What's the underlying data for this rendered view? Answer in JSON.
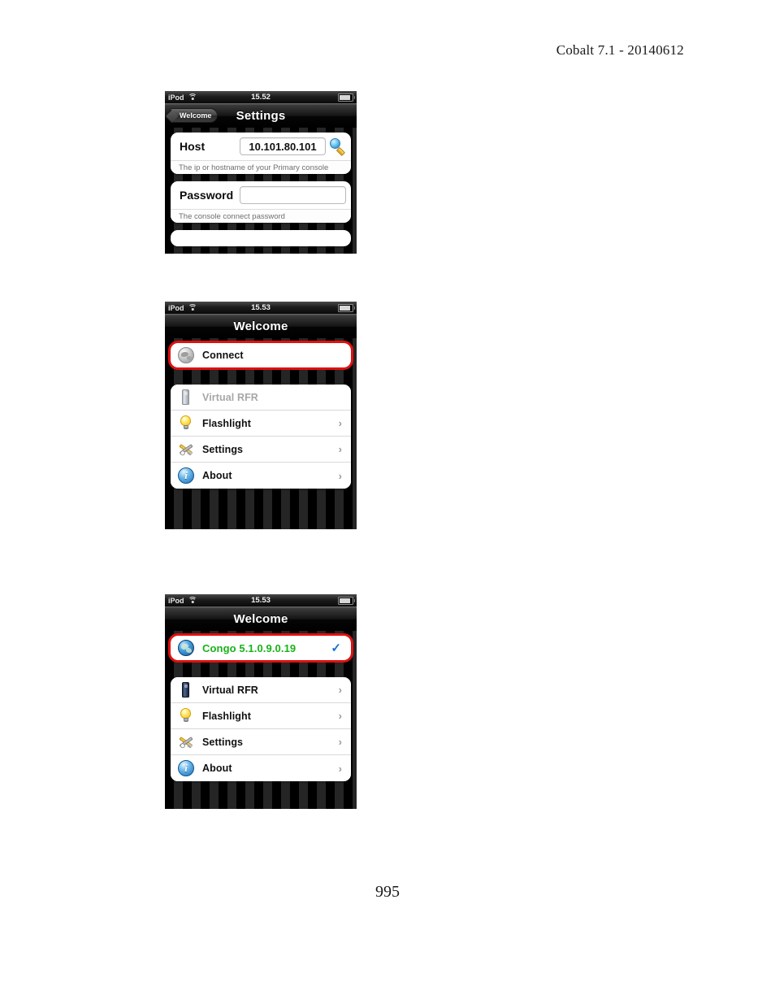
{
  "document": {
    "header": "Cobalt 7.1 - 20140612",
    "page_number": "995"
  },
  "screens": [
    {
      "id": "settings",
      "status_bar": {
        "carrier": "iPod",
        "wifi_icon": "wifi-icon",
        "time": "15.52",
        "battery_icon": "battery-icon"
      },
      "nav": {
        "back_label": "Welcome",
        "title": "Settings"
      },
      "fields": [
        {
          "label": "Host",
          "value": "10.101.80.101",
          "placeholder": "",
          "accessory_icon": "magnifier-icon",
          "hint": "The ip or hostname of your Primary console"
        },
        {
          "label": "Password",
          "value": "",
          "placeholder": "",
          "accessory_icon": "",
          "hint": "The console connect password"
        }
      ]
    },
    {
      "id": "welcome-disconnected",
      "status_bar": {
        "carrier": "iPod",
        "wifi_icon": "wifi-icon",
        "time": "15.53",
        "battery_icon": "battery-icon"
      },
      "nav": {
        "back_label": "",
        "title": "Welcome"
      },
      "highlighted_row": {
        "label": "Connect",
        "icon": "globe-icon-gray",
        "highlight_color": "#e01010",
        "accessory": ""
      },
      "menu": [
        {
          "label": "Virtual RFR",
          "icon": "rfr-icon",
          "state": "disabled",
          "accessory": ""
        },
        {
          "label": "Flashlight",
          "icon": "bulb-icon",
          "state": "enabled",
          "accessory": "›"
        },
        {
          "label": "Settings",
          "icon": "tools-icon",
          "state": "enabled",
          "accessory": "›"
        },
        {
          "label": "About",
          "icon": "info-icon",
          "state": "enabled",
          "accessory": "›"
        }
      ]
    },
    {
      "id": "welcome-connected",
      "status_bar": {
        "carrier": "iPod",
        "wifi_icon": "wifi-icon",
        "time": "15.53",
        "battery_icon": "battery-icon"
      },
      "nav": {
        "back_label": "",
        "title": "Welcome"
      },
      "highlighted_row": {
        "label": "Congo 5.1.0.9.0.19",
        "icon": "globe-icon-blue",
        "highlight_color": "#e01010",
        "accessory": "✓",
        "label_color": "#17b317"
      },
      "menu": [
        {
          "label": "Virtual RFR",
          "icon": "rfr-icon-active",
          "state": "enabled",
          "accessory": "›"
        },
        {
          "label": "Flashlight",
          "icon": "bulb-icon",
          "state": "enabled",
          "accessory": "›"
        },
        {
          "label": "Settings",
          "icon": "tools-icon",
          "state": "enabled",
          "accessory": "›"
        },
        {
          "label": "About",
          "icon": "info-icon",
          "state": "enabled",
          "accessory": "›"
        }
      ]
    }
  ]
}
